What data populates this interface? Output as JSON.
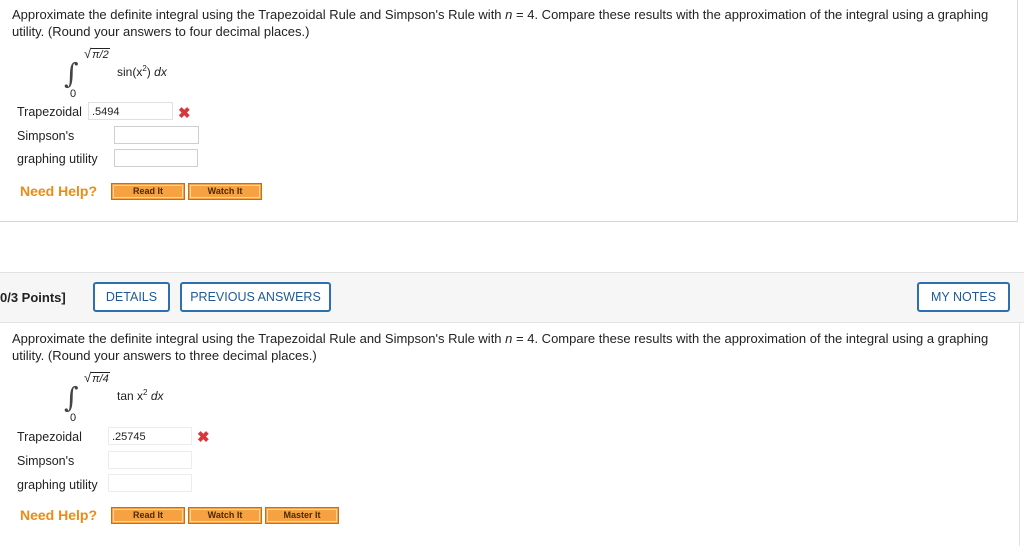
{
  "problem1": {
    "text_line1": "Approximate the definite integral using the Trapezoidal Rule and Simpson's Rule with",
    "n_var": "n",
    "text_eq": " = 4. Compare these results with the approximation of the integral using a graphing",
    "text_line2": "utility. (Round your answers to four decimal places.)",
    "upper_limit": "π/2",
    "lower_limit": "0",
    "integrand_fn": "sin(x",
    "integrand_exp": "2",
    "integrand_close": ")",
    "integrand_dx": "dx",
    "rows": [
      {
        "label": "Trapezoidal",
        "value": ".5494",
        "mark": "✖"
      },
      {
        "label": "Simpson's",
        "value": ""
      },
      {
        "label": "graphing utility",
        "value": ""
      }
    ],
    "need_help": "Need Help?",
    "buttons": [
      "Read It",
      "Watch It"
    ]
  },
  "problem2": {
    "points": "0/3 Points]",
    "details_btn": "DETAILS",
    "previous_btn": "PREVIOUS ANSWERS",
    "notes_btn": "MY NOTES",
    "text_line1": "Approximate the definite integral using the Trapezoidal Rule and Simpson's Rule with",
    "n_var": "n",
    "text_eq": " = 4. Compare these results with the approximation of the integral using a graphing",
    "text_line2": "utility. (Round your answers to three decimal places.)",
    "upper_limit": "π/4",
    "lower_limit": "0",
    "integrand_fn": "tan x",
    "integrand_exp": "2",
    "integrand_dx": "dx",
    "rows": [
      {
        "label": "Trapezoidal",
        "value": ".25745",
        "mark": "✖"
      },
      {
        "label": "Simpson's",
        "value": ""
      },
      {
        "label": "graphing utility",
        "value": ""
      }
    ],
    "need_help": "Need Help?",
    "buttons": [
      "Read It",
      "Watch It",
      "Master It"
    ]
  },
  "colors": {
    "accent_blue": "#2e6fb0",
    "help_orange": "#f08a12",
    "button_orange": "#f6a243",
    "incorrect_red": "#d9363e",
    "panel_gray": "#f6f6f6"
  }
}
